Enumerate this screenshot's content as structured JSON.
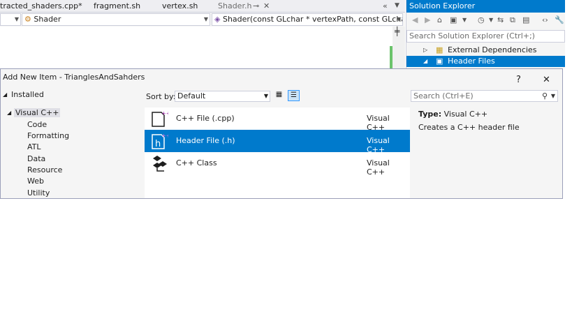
{
  "ide": {
    "tabs": [
      {
        "label": "tracted_shaders.cpp*"
      },
      {
        "label": "fragment.sh"
      },
      {
        "label": "vertex.sh"
      },
      {
        "label": "Shader.h"
      }
    ],
    "tab_pin_glyph": "⊸",
    "tab_close_glyph": "✕",
    "nav": {
      "class_combo": "Shader",
      "member_combo": "Shader(const GLchar * vertexPath, const GLchar * frag"
    }
  },
  "solution_explorer": {
    "title": "Solution Explorer",
    "search_placeholder": "Search Solution Explorer (Ctrl+;)",
    "items": [
      {
        "label": "External Dependencies"
      },
      {
        "label": "Header Files"
      }
    ]
  },
  "dialog": {
    "title": "Add New Item - TrianglesAndSahders",
    "help_glyph": "?",
    "close_glyph": "✕",
    "tree": {
      "installed": "Installed",
      "root": "Visual C++",
      "children": [
        "Code",
        "Formatting",
        "ATL",
        "Data",
        "Resource",
        "Web",
        "Utility"
      ]
    },
    "sort_label": "Sort by:",
    "sort_value": "Default",
    "search_placeholder": "Search (Ctrl+E)",
    "templates": [
      {
        "name": "C++ File (.cpp)",
        "category": "Visual C++",
        "icon": "cpp-file-icon"
      },
      {
        "name": "Header File (.h)",
        "category": "Visual C++",
        "icon": "header-file-icon"
      },
      {
        "name": "C++ Class",
        "category": "Visual C++",
        "icon": "cpp-class-icon"
      }
    ],
    "selected_index": 1,
    "detail": {
      "type_label": "Type:",
      "type_value": "Visual C++",
      "description": "Creates a C++ header file"
    }
  },
  "colors": {
    "accent": "#007acc",
    "dialog_bg": "#f5f5f5",
    "green_marker": "#6bc36b"
  }
}
